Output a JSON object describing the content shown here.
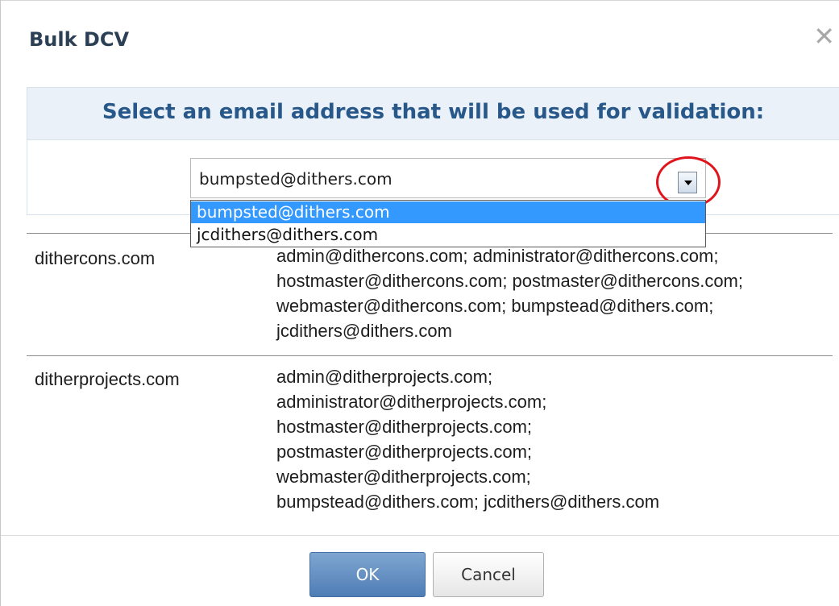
{
  "dialog": {
    "title": "Bulk DCV",
    "close_glyph": "✕"
  },
  "prompt": "Select an email address that will be used for validation:",
  "combo": {
    "value": "bumpsted@dithers.com",
    "options": [
      {
        "label": "bumpsted@dithers.com",
        "selected": true
      },
      {
        "label": "jcdithers@dithers.com",
        "selected": false
      }
    ]
  },
  "highlight_color": "#e0141c",
  "domains": [
    {
      "name": "dithercons.com",
      "emails": "admin@dithercons.com; administrator@dithercons.com;\nhostmaster@dithercons.com; postmaster@dithercons.com;\nwebmaster@dithercons.com; bumpstead@dithers.com;\njcdithers@dithers.com"
    },
    {
      "name": "ditherprojects.com",
      "emails": "admin@ditherprojects.com;\nadministrator@ditherprojects.com;\nhostmaster@ditherprojects.com;\npostmaster@ditherprojects.com;\nwebmaster@ditherprojects.com;\nbumpstead@dithers.com; jcdithers@dithers.com"
    }
  ],
  "buttons": {
    "ok": "OK",
    "cancel": "Cancel"
  }
}
